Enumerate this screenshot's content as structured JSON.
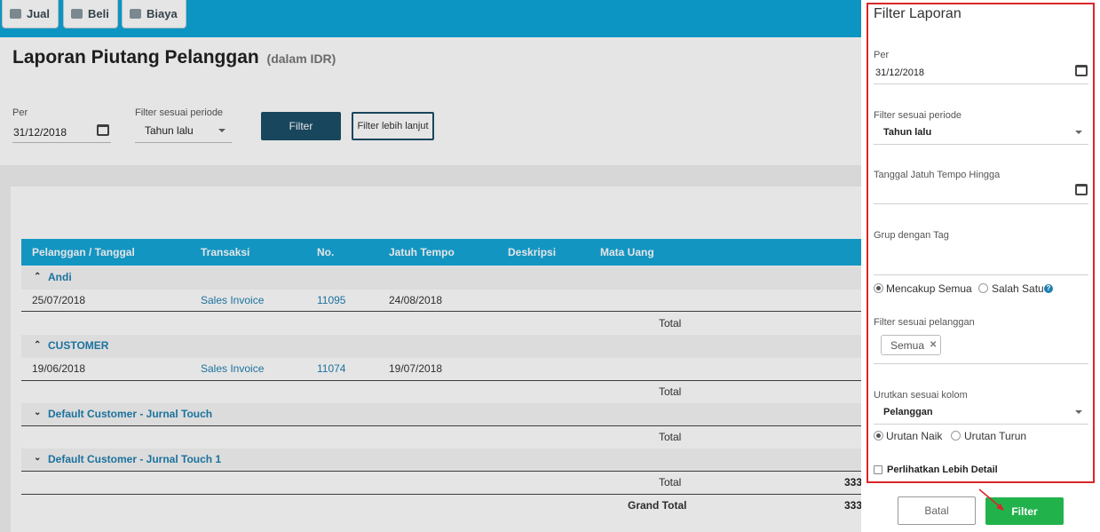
{
  "topbar": {
    "buttons": [
      {
        "label": "Jual",
        "icon": "tag-icon"
      },
      {
        "label": "Beli",
        "icon": "card-icon"
      },
      {
        "label": "Biaya",
        "icon": "receipt-icon"
      }
    ]
  },
  "page": {
    "title": "Laporan Piutang Pelanggan",
    "subtitle": "(dalam IDR)"
  },
  "filters": {
    "per_label": "Per",
    "per_value": "31/12/2018",
    "period_label": "Filter sesuai periode",
    "period_value": "Tahun lalu",
    "filter_button": "Filter",
    "more_button": "Filter lebih lanjut"
  },
  "table": {
    "headers": [
      "Pelanggan / Tanggal",
      "Transaksi",
      "No.",
      "Jatuh Tempo",
      "Deskripsi",
      "Mata Uang"
    ],
    "groups": [
      {
        "name": "Andi",
        "expanded": true,
        "row": {
          "date": "25/07/2018",
          "transaction": "Sales Invoice",
          "number": "11095",
          "due": "24/08/2018"
        },
        "total_label": "Total"
      },
      {
        "name": "CUSTOMER",
        "expanded": true,
        "row": {
          "date": "19/06/2018",
          "transaction": "Sales Invoice",
          "number": "11074",
          "due": "19/07/2018"
        },
        "total_label": "Total"
      },
      {
        "name": "Default Customer - Jurnal Touch",
        "expanded": false,
        "total_label": "Total"
      },
      {
        "name": "Default Customer - Jurnal Touch 1",
        "expanded": false,
        "total_label": "Total"
      }
    ],
    "grand_total_label": "Grand Total",
    "truncated_totals": [
      "333",
      "333"
    ]
  },
  "panel": {
    "title": "Filter Laporan",
    "per_label": "Per",
    "per_value": "31/12/2018",
    "period_label": "Filter sesuai periode",
    "period_value": "Tahun lalu",
    "due_label": "Tanggal Jatuh Tempo Hingga",
    "due_value": "",
    "tag_label": "Grup dengan Tag",
    "tag_mode_options": [
      "Mencakup Semua",
      "Salah Satu"
    ],
    "tag_mode_selected": "Mencakup Semua",
    "customer_label": "Filter sesuai pelanggan",
    "customer_tag": "Semua",
    "sort_label": "Urutkan sesuai kolom",
    "sort_value": "Pelanggan",
    "order_options": [
      "Urutan Naik",
      "Urutan Turun"
    ],
    "order_selected": "Urutan Naik",
    "detail_label": "Perlihatkan Lebih Detail",
    "detail_checked": false,
    "cancel_button": "Batal",
    "submit_button": "Filter"
  },
  "colors": {
    "topbar": "#0ea5d8",
    "table_header": "#16a6d9",
    "link": "#1f7fb0",
    "primary_dark": "#1b4f68",
    "submit": "#22b24c",
    "highlight": "#d9262a"
  }
}
